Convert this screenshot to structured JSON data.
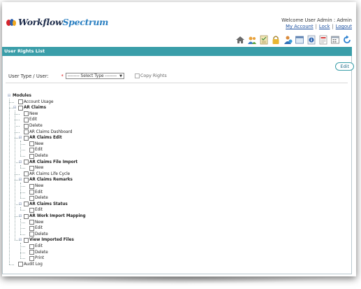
{
  "app": {
    "brand_part1": "Workflow",
    "brand_part2": "Spectrum",
    "welcome_text": "Welcome User Admin : Admin",
    "links": {
      "my_account": "My Account",
      "lock": "Lock",
      "logout": "Logout",
      "separator": "|"
    }
  },
  "toolbar": {
    "icons": [
      "home-icon",
      "users-icon",
      "checklist-icon",
      "lock-icon",
      "user-group-icon",
      "window-icon",
      "info-icon",
      "document-icon",
      "calendar-icon",
      "refresh-icon"
    ]
  },
  "section": {
    "title": "User Rights List",
    "edit_label": "Edit"
  },
  "form": {
    "user_type_label": "User Type / User:",
    "required_mark": "*",
    "select_value": "-------- Select Type --------",
    "copy_rights_label": "Copy Rights"
  },
  "tree": [
    {
      "label": "Modules",
      "level": 0,
      "expanded": true,
      "bold": true,
      "checkbox": false
    },
    {
      "label": "Account Usage",
      "level": 1,
      "bold": false,
      "checkbox": true
    },
    {
      "label": "AR Claims",
      "level": 1,
      "expanded": true,
      "bold": true,
      "checkbox": true
    },
    {
      "label": "New",
      "level": 2,
      "bold": false,
      "checkbox": true
    },
    {
      "label": "Edit",
      "level": 2,
      "bold": false,
      "checkbox": true
    },
    {
      "label": "Delete",
      "level": 2,
      "bold": false,
      "checkbox": true
    },
    {
      "label": "AR Claims Dashboard",
      "level": 2,
      "bold": false,
      "checkbox": true
    },
    {
      "label": "AR Claims Edit",
      "level": 2,
      "expanded": true,
      "bold": true,
      "checkbox": true
    },
    {
      "label": "New",
      "level": 3,
      "bold": false,
      "checkbox": true
    },
    {
      "label": "Edit",
      "level": 3,
      "bold": false,
      "checkbox": true
    },
    {
      "label": "Delete",
      "level": 3,
      "bold": false,
      "checkbox": true
    },
    {
      "label": "AR Claims File Import",
      "level": 2,
      "expanded": true,
      "bold": true,
      "checkbox": true
    },
    {
      "label": "New",
      "level": 3,
      "bold": false,
      "checkbox": true
    },
    {
      "label": "AR Claims Life Cycle",
      "level": 2,
      "bold": false,
      "checkbox": true
    },
    {
      "label": "AR Claims Remarks",
      "level": 2,
      "expanded": true,
      "bold": true,
      "checkbox": true
    },
    {
      "label": "New",
      "level": 3,
      "bold": false,
      "checkbox": true
    },
    {
      "label": "Edit",
      "level": 3,
      "bold": false,
      "checkbox": true
    },
    {
      "label": "Delete",
      "level": 3,
      "bold": false,
      "checkbox": true
    },
    {
      "label": "AR Claims Status",
      "level": 2,
      "expanded": true,
      "bold": true,
      "checkbox": true
    },
    {
      "label": "Edit",
      "level": 3,
      "bold": false,
      "checkbox": true
    },
    {
      "label": "AR Work Import Mapping",
      "level": 2,
      "expanded": true,
      "bold": true,
      "checkbox": true
    },
    {
      "label": "New",
      "level": 3,
      "bold": false,
      "checkbox": true
    },
    {
      "label": "Edit",
      "level": 3,
      "bold": false,
      "checkbox": true
    },
    {
      "label": "Delete",
      "level": 3,
      "bold": false,
      "checkbox": true
    },
    {
      "label": "View Imported Files",
      "level": 2,
      "expanded": true,
      "bold": true,
      "checkbox": true
    },
    {
      "label": "Edit",
      "level": 3,
      "bold": false,
      "checkbox": true
    },
    {
      "label": "Delete",
      "level": 3,
      "bold": false,
      "checkbox": true
    },
    {
      "label": "Print",
      "level": 3,
      "bold": false,
      "checkbox": true
    },
    {
      "label": "Audit Log",
      "level": 1,
      "bold": false,
      "checkbox": true
    }
  ]
}
